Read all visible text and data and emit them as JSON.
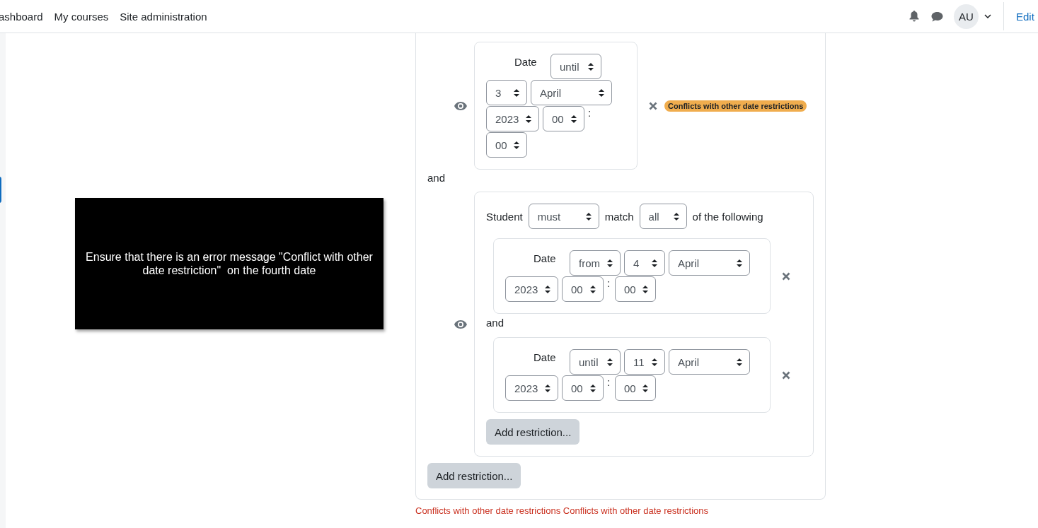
{
  "nav": {
    "links": [
      "ashboard",
      "My courses",
      "Site administration"
    ],
    "avatar": "AU",
    "edit": "Edit"
  },
  "caption": "Ensure that there is an error message \"Conflict with other date restriction\"  on the fourth date",
  "conditions": [
    {
      "kind": "date",
      "label": "Date",
      "badge": "Conflicts with other date restrictions",
      "fields": [
        {
          "kind": "direction",
          "value": "until"
        },
        {
          "kind": "day",
          "value": "3"
        },
        {
          "kind": "month",
          "value": "April"
        },
        {
          "kind": "year",
          "value": "2023"
        },
        {
          "kind": "hour",
          "value": "00"
        },
        {
          "kind": "separator",
          "value": ":"
        },
        {
          "kind": "minute",
          "value": "00"
        }
      ]
    },
    {
      "kind": "set",
      "connector": "and",
      "student_label": "Student",
      "must": "must",
      "match_label": "match",
      "all": "all",
      "following_label": "of the following",
      "add_button": "Add restriction...",
      "items": [
        {
          "label": "Date",
          "fields": [
            {
              "kind": "direction",
              "value": "from"
            },
            {
              "kind": "day",
              "value": "4"
            },
            {
              "kind": "month",
              "value": "April"
            },
            {
              "kind": "year",
              "value": "2023"
            },
            {
              "kind": "hour",
              "value": "00"
            },
            {
              "kind": "separator",
              "value": ":"
            },
            {
              "kind": "minute",
              "value": "00"
            }
          ]
        },
        {
          "connector": "and",
          "label": "Date",
          "fields": [
            {
              "kind": "direction",
              "value": "until"
            },
            {
              "kind": "day",
              "value": "11"
            },
            {
              "kind": "month",
              "value": "April"
            },
            {
              "kind": "year",
              "value": "2023"
            },
            {
              "kind": "hour",
              "value": "00"
            },
            {
              "kind": "separator",
              "value": ":"
            },
            {
              "kind": "minute",
              "value": "00"
            }
          ]
        }
      ]
    }
  ],
  "add_button": "Add restriction...",
  "error": "Conflicts with other date restrictions Conflicts with other date restrictions"
}
